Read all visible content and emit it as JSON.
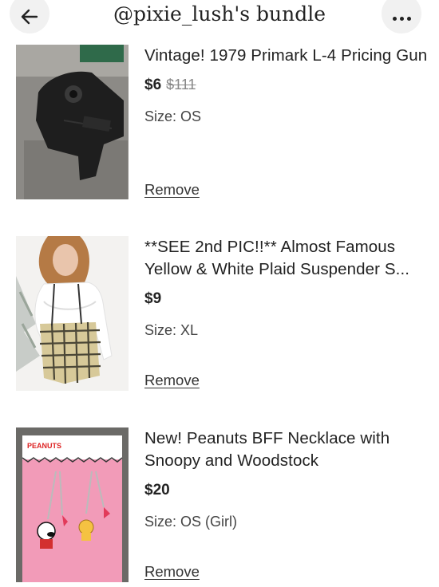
{
  "header": {
    "title": "@pixie_lush's bundle",
    "back_icon": "arrow-left-icon",
    "more_icon": "ellipsis-icon"
  },
  "items": [
    {
      "title": "Vintage! 1979 Primark L-4 Pricing Gun",
      "price": "$6",
      "original_price": "$111",
      "size": "Size: OS",
      "remove_label": "Remove"
    },
    {
      "title": "**SEE 2nd PIC!!** Almost Famous Yellow & White Plaid Suspender S...",
      "price": "$9",
      "original_price": "",
      "size": "Size: XL",
      "remove_label": "Remove"
    },
    {
      "title": "New! Peanuts BFF Necklace with Snoopy and Woodstock",
      "price": "$20",
      "original_price": "",
      "size": "Size: OS (Girl)",
      "remove_label": "Remove",
      "card_brand": "PEANUTS"
    }
  ]
}
